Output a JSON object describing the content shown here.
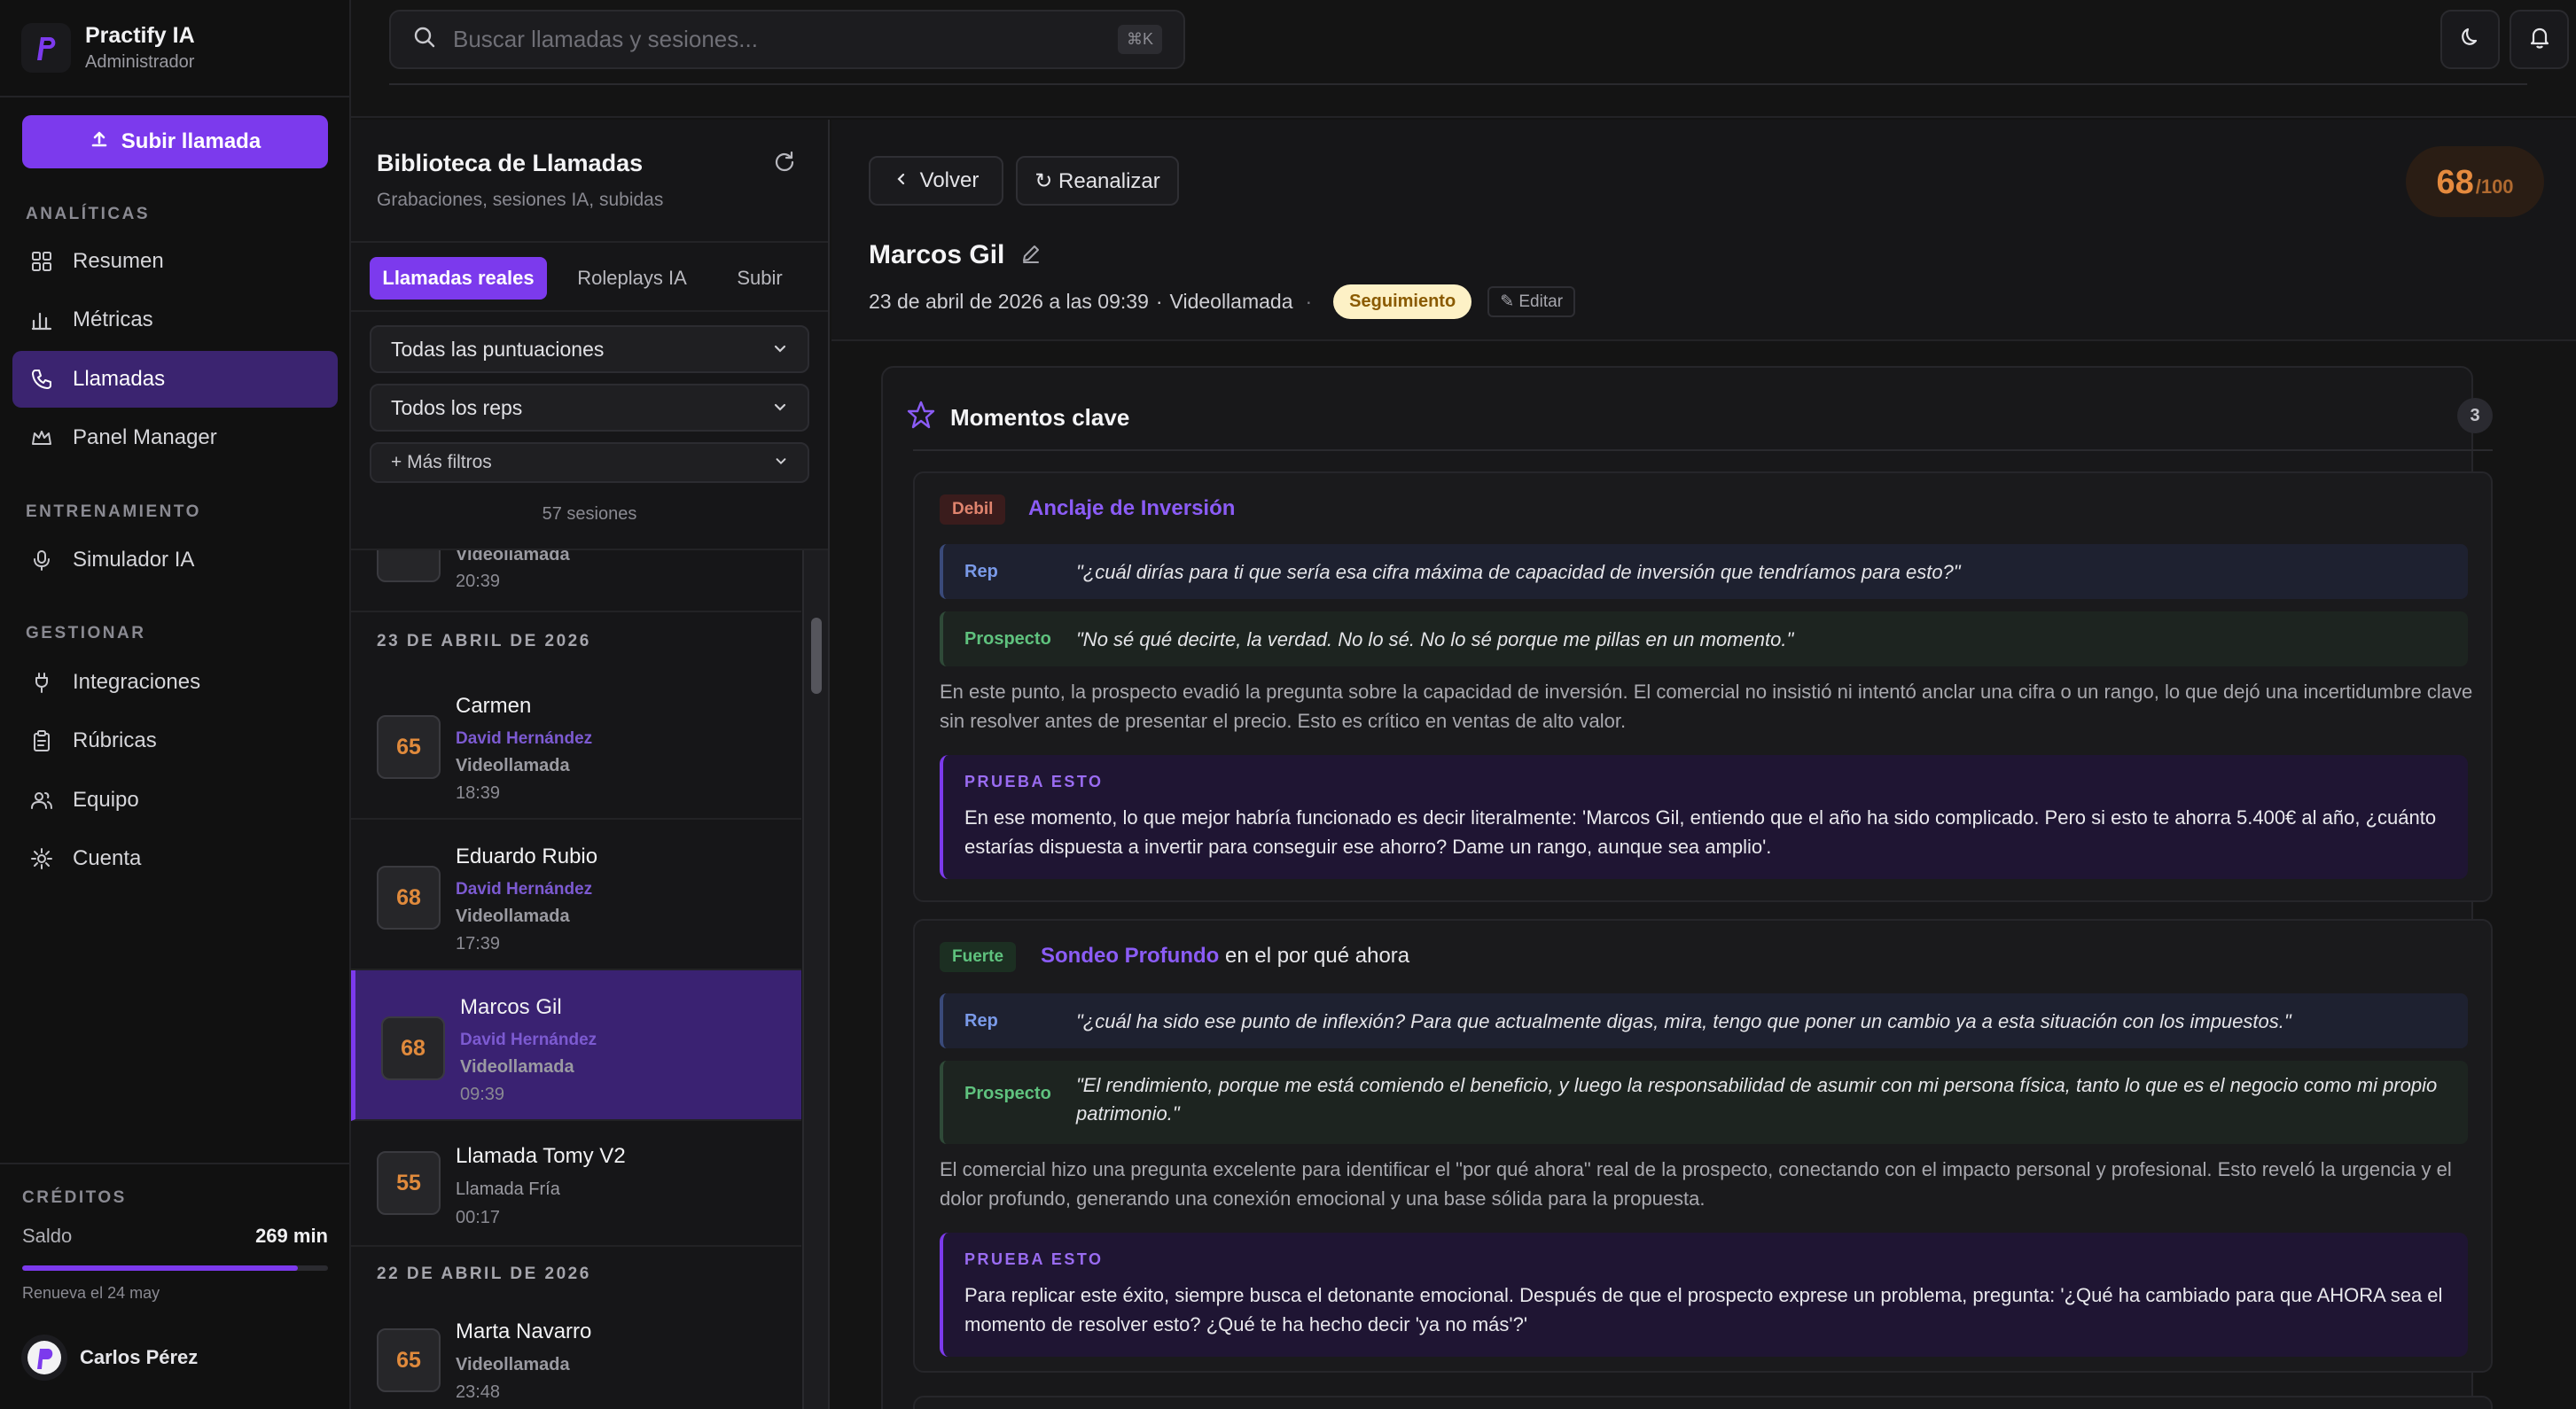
{
  "app": {
    "name": "Practify IA",
    "role": "Administrador"
  },
  "sidebar": {
    "upload_label": "Subir llamada",
    "sections": {
      "analytics": "ANALÍTICAS",
      "training": "ENTRENAMIENTO",
      "manage": "GESTIONAR"
    },
    "items": [
      {
        "label": "Resumen",
        "icon": "grid-icon"
      },
      {
        "label": "Métricas",
        "icon": "bar-chart-icon"
      },
      {
        "label": "Llamadas",
        "icon": "phone-icon",
        "active": true
      },
      {
        "label": "Panel Manager",
        "icon": "crown-icon"
      },
      {
        "label": "Simulador IA",
        "icon": "microphone-icon"
      },
      {
        "label": "Integraciones",
        "icon": "plug-icon"
      },
      {
        "label": "Rúbricas",
        "icon": "clipboard-icon"
      },
      {
        "label": "Equipo",
        "icon": "users-icon"
      },
      {
        "label": "Cuenta",
        "icon": "gear-icon"
      }
    ],
    "credits": {
      "title": "CRÉDITOS",
      "balance_label": "Saldo",
      "balance_value": "269 min",
      "fill_fraction": 0.9,
      "renew": "Renueva el 24 may"
    },
    "user": {
      "name": "Carlos Pérez"
    }
  },
  "topbar": {
    "search_placeholder": "Buscar llamadas y sesiones...",
    "shortcut": "⌘K"
  },
  "library": {
    "title": "Biblioteca de Llamadas",
    "subtitle": "Grabaciones, sesiones IA, subidas",
    "tabs": [
      "Llamadas reales",
      "Roleplays IA",
      "Subir"
    ],
    "filters": {
      "scores": "Todas las puntuaciones",
      "reps": "Todos los reps",
      "more": "+ Más filtros"
    },
    "sessions_count": "57 sesiones",
    "partial_item": {
      "type": "Videollamada",
      "time": "20:39"
    },
    "groups": [
      {
        "date": "23 DE ABRIL DE 2026",
        "calls": [
          {
            "name": "Carmen",
            "rep": "David Hernández",
            "type": "Videollamada",
            "time": "18:39",
            "score": "65"
          },
          {
            "name": "Eduardo Rubio",
            "rep": "David Hernández",
            "type": "Videollamada",
            "time": "17:39",
            "score": "68"
          },
          {
            "name": "Marcos Gil",
            "rep": "David Hernández",
            "type": "Videollamada",
            "time": "09:39",
            "score": "68"
          },
          {
            "name": "Llamada Tomy V2",
            "rep": "",
            "type": "Llamada Fría",
            "time": "00:17",
            "score": "55"
          }
        ]
      },
      {
        "date": "22 DE ABRIL DE 2026",
        "calls": [
          {
            "name": "Marta Navarro",
            "rep": "",
            "type": "Videollamada",
            "time": "23:48",
            "score": "65"
          }
        ]
      }
    ]
  },
  "detail": {
    "back_label": "Volver",
    "reanalyze_label": "↻ Reanalizar",
    "score": "68",
    "score_max": "/100",
    "name": "Marcos Gil",
    "date": "23 de abril de 2026 a las 09:39",
    "separator": "·",
    "call_type": "Videollamada",
    "status": "Seguimiento",
    "edit_label": "✎ Editar",
    "moments_title": "Momentos clave",
    "moments_count": "3",
    "moments": [
      {
        "tag": "Debil",
        "title_highlight": "Anclaje de Inversión",
        "title_rest": "",
        "rep_label": "Rep",
        "rep_quote": "\"¿cuál dirías para ti que sería esa cifra máxima de capacidad de inversión que tendríamos para esto?\"",
        "prospect_label": "Prospecto",
        "prospect_quote": "\"No sé qué decirte, la verdad. No lo sé. No lo sé porque me pillas en un momento.\"",
        "explanation": "En este punto, la prospecto evadió la pregunta sobre la capacidad de inversión. El comercial no insistió ni intentó anclar una cifra o un rango, lo que dejó una incertidumbre clave sin resolver antes de presentar el precio. Esto es crítico en ventas de alto valor.",
        "tip_title": "PRUEBA ESTO",
        "tip": "En ese momento, lo que mejor habría funcionado es decir literalmente: 'Marcos Gil, entiendo que el año ha sido complicado. Pero si esto te ahorra 5.400€ al año, ¿cuánto estarías dispuesta a invertir para conseguir ese ahorro? Dame un rango, aunque sea amplio'."
      },
      {
        "tag": "Fuerte",
        "title_highlight": "Sondeo Profundo",
        "title_rest": " en el por qué ahora",
        "rep_label": "Rep",
        "rep_quote": "\"¿cuál ha sido ese punto de inflexión? Para que actualmente digas, mira, tengo que poner un cambio ya a esta situación con los impuestos.\"",
        "prospect_label": "Prospecto",
        "prospect_quote": "\"El rendimiento, porque me está comiendo el beneficio, y luego la responsabilidad de asumir con mi persona física, tanto lo que es el negocio como mi propio patrimonio.\"",
        "explanation": "El comercial hizo una pregunta excelente para identificar el \"por qué ahora\" real de la prospecto, conectando con el impacto personal y profesional. Esto reveló la urgencia y el dolor profundo, generando una conexión emocional y una base sólida para la propuesta.",
        "tip_title": "PRUEBA ESTO",
        "tip": "Para replicar este éxito, siempre busca el detonante emocional. Después de que el prospecto exprese un problema, pregunta: '¿Qué ha cambiado para que AHORA sea el momento de resolver esto? ¿Qué te ha hecho decir 'ya no más'?'"
      }
    ]
  },
  "colors": {
    "accent": "#7c3aed",
    "score": "#e58a3e",
    "weak": "#e0846e",
    "strong": "#5fc27e"
  }
}
